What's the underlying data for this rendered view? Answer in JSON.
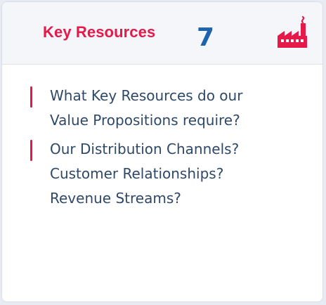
{
  "card": {
    "title": "Key Resources",
    "number": "7",
    "icon": "factory-icon",
    "accent_color": "#e5194a",
    "number_color": "#1e63ad",
    "text_color": "#2e4868"
  },
  "questions": [
    {
      "lines": [
        "What Key Resources do our",
        "Value Propositions require?"
      ]
    },
    {
      "lines": [
        "Our Distribution Channels?",
        "Customer Relationships?",
        "Revenue Streams?"
      ]
    }
  ]
}
